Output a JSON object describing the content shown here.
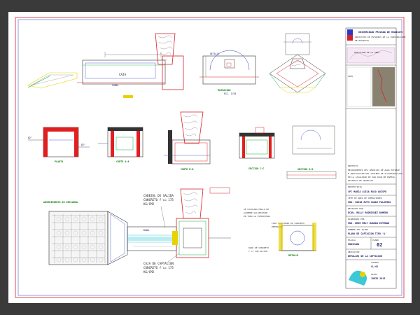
{
  "title_block": {
    "university": "UNIVERSIDAD PRIVADA DE HUANCAYO",
    "institute": "INSTITUTO DE ESTUDIOS DE LA CONSTRUCCION",
    "province": "DE HUANCAYO",
    "location_note": "UBICACION DE LA OBRA",
    "project_label": "PROYECTO",
    "project_text": [
      "MEJORAMIENTO DEL SERVICIO DE AGUA POTABLE",
      "E INSTALACION DEL SISTEMA DE ALCANTARILLADO",
      "EN LA LOCALIDAD DE SAN JUAN DE PAMPAS,",
      "DISTRITO DE HUANCAYO"
    ],
    "designer_label": "PROYECTISTA",
    "designer": "CPC MARIA LUISA ROJO QUISPE",
    "chief_label": "JEFE DE AREA DE OPERACIONES",
    "chief": "ING. SONIA RUTH CANAZ PALOMINO",
    "reviewer_label": "REVISADO POR",
    "reviewer": "ECON. ROLLY RODRIGUEZ ROMERO",
    "drawn_label": "ELABORADO POR",
    "drawn": "ING. NEIR MELY HUAMAN ESTEBAN",
    "drawing_label": "NOMBRE DEL PLANO",
    "drawing": "PLANO DE CAPTACION TIPO 'A'",
    "scale_label": "ESCALA",
    "scale": "INDICADA",
    "sheet_label": "LAMINA",
    "sheet": "CL-02",
    "date_label": "FECHA",
    "date": "JUNIO 2013",
    "ubic_label": "UBICACION",
    "ubic": "DETALLES DE LA CAPTACION",
    "plano_label": "PLANO",
    "plano": "02"
  },
  "views": {
    "elev_title": "ELEVACION",
    "elev_scale": "ESC. 1/50",
    "planta_title": "PLANTA",
    "corte_a": "CORTE A-A",
    "corte_b": "CORTE B-B",
    "corte_c": "SECCION C-C",
    "corte_d": "SECCION D-D",
    "plan_title": "ADVENIMIENTO DE DESCARGA",
    "canal": "CANAL",
    "detail_note": "DETALLE"
  },
  "notes": {
    "cabezal": [
      "CABEZAL DE SALIDA",
      "CONCRETO f'c= 175",
      "KG/CM2"
    ],
    "caja": [
      "CAJA DE CAPTACION",
      "CONCRETO f'c= 175",
      "KG/CM2"
    ],
    "tapa": [
      "TAPA SANITARIA DE CONCRETO",
      "REFORZADO"
    ],
    "dado": [
      "DADO DE CONCRETO",
      "f'c= 140 KG/CM2"
    ],
    "general": [
      "SE COLOCARA MALLA DE",
      "ALAMBRE GALVANIZADO",
      "EN TODA LA ESTRUCTURA"
    ]
  },
  "colors": {
    "frame_red": "#d3202a",
    "frame_blue": "#2a3ac8",
    "line_dark": "#333333",
    "concrete_red": "#e02020",
    "fill_green": "#0ab23c",
    "fill_cyan": "#3cc8d6",
    "fill_yellow": "#e8d200"
  }
}
